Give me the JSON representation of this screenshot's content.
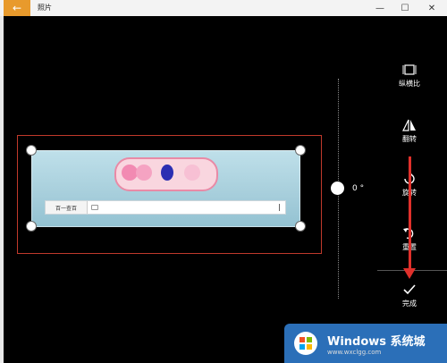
{
  "window": {
    "title": "照片",
    "back_icon": "back-arrow-icon"
  },
  "controls": {
    "minimize": "—",
    "maximize": "☐",
    "close": "✕"
  },
  "editor": {
    "rotation_value": "0 °",
    "photo": {
      "search_button": "百一查百"
    }
  },
  "tools": [
    {
      "icon": "aspect-ratio-icon",
      "label": "纵横比"
    },
    {
      "icon": "flip-icon",
      "label": "翻转"
    },
    {
      "icon": "rotate-icon",
      "label": "旋转"
    },
    {
      "icon": "reset-icon",
      "label": "重置"
    },
    {
      "icon": "checkmark-icon",
      "label": "完成"
    }
  ],
  "watermark": {
    "text": "Windows 系统城",
    "sub": "www.wxclgg.com"
  },
  "colors": {
    "accent": "#e89a2c",
    "annotation": "#e0302b"
  }
}
